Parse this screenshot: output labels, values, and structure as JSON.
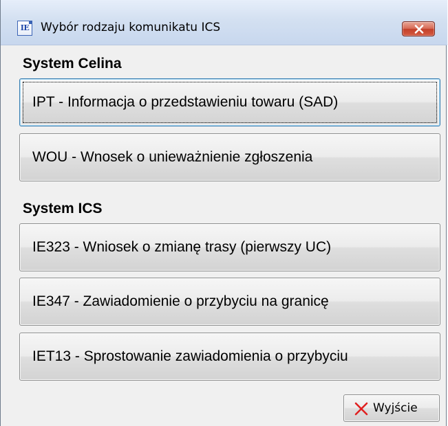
{
  "window": {
    "title": "Wybór rodzaju komunikatu ICS",
    "icon_text": "IE",
    "icon_name": "ie-document-icon",
    "close_icon_name": "close-icon"
  },
  "sections": [
    {
      "heading": "System Celina",
      "buttons": [
        "IPT - Informacja o przedstawieniu towaru (SAD)",
        "WOU - Wnosek o unieważnienie zgłoszenia"
      ]
    },
    {
      "heading": "System ICS",
      "buttons": [
        "IE323 - Wniosek o zmianę trasy (pierwszy UC)",
        "IE347 - Zawiadomienie o przybyciu na granicę",
        "IET13 - Sprostowanie zawiadomienia o przybyciu"
      ]
    }
  ],
  "footer": {
    "exit_label": "Wyjście",
    "exit_icon_name": "red-x-icon"
  },
  "colors": {
    "titlebar": "#d3e0f1",
    "close_button": "#c3412a",
    "focus_border": "#3c7fb1",
    "exit_x": "#e02020"
  }
}
